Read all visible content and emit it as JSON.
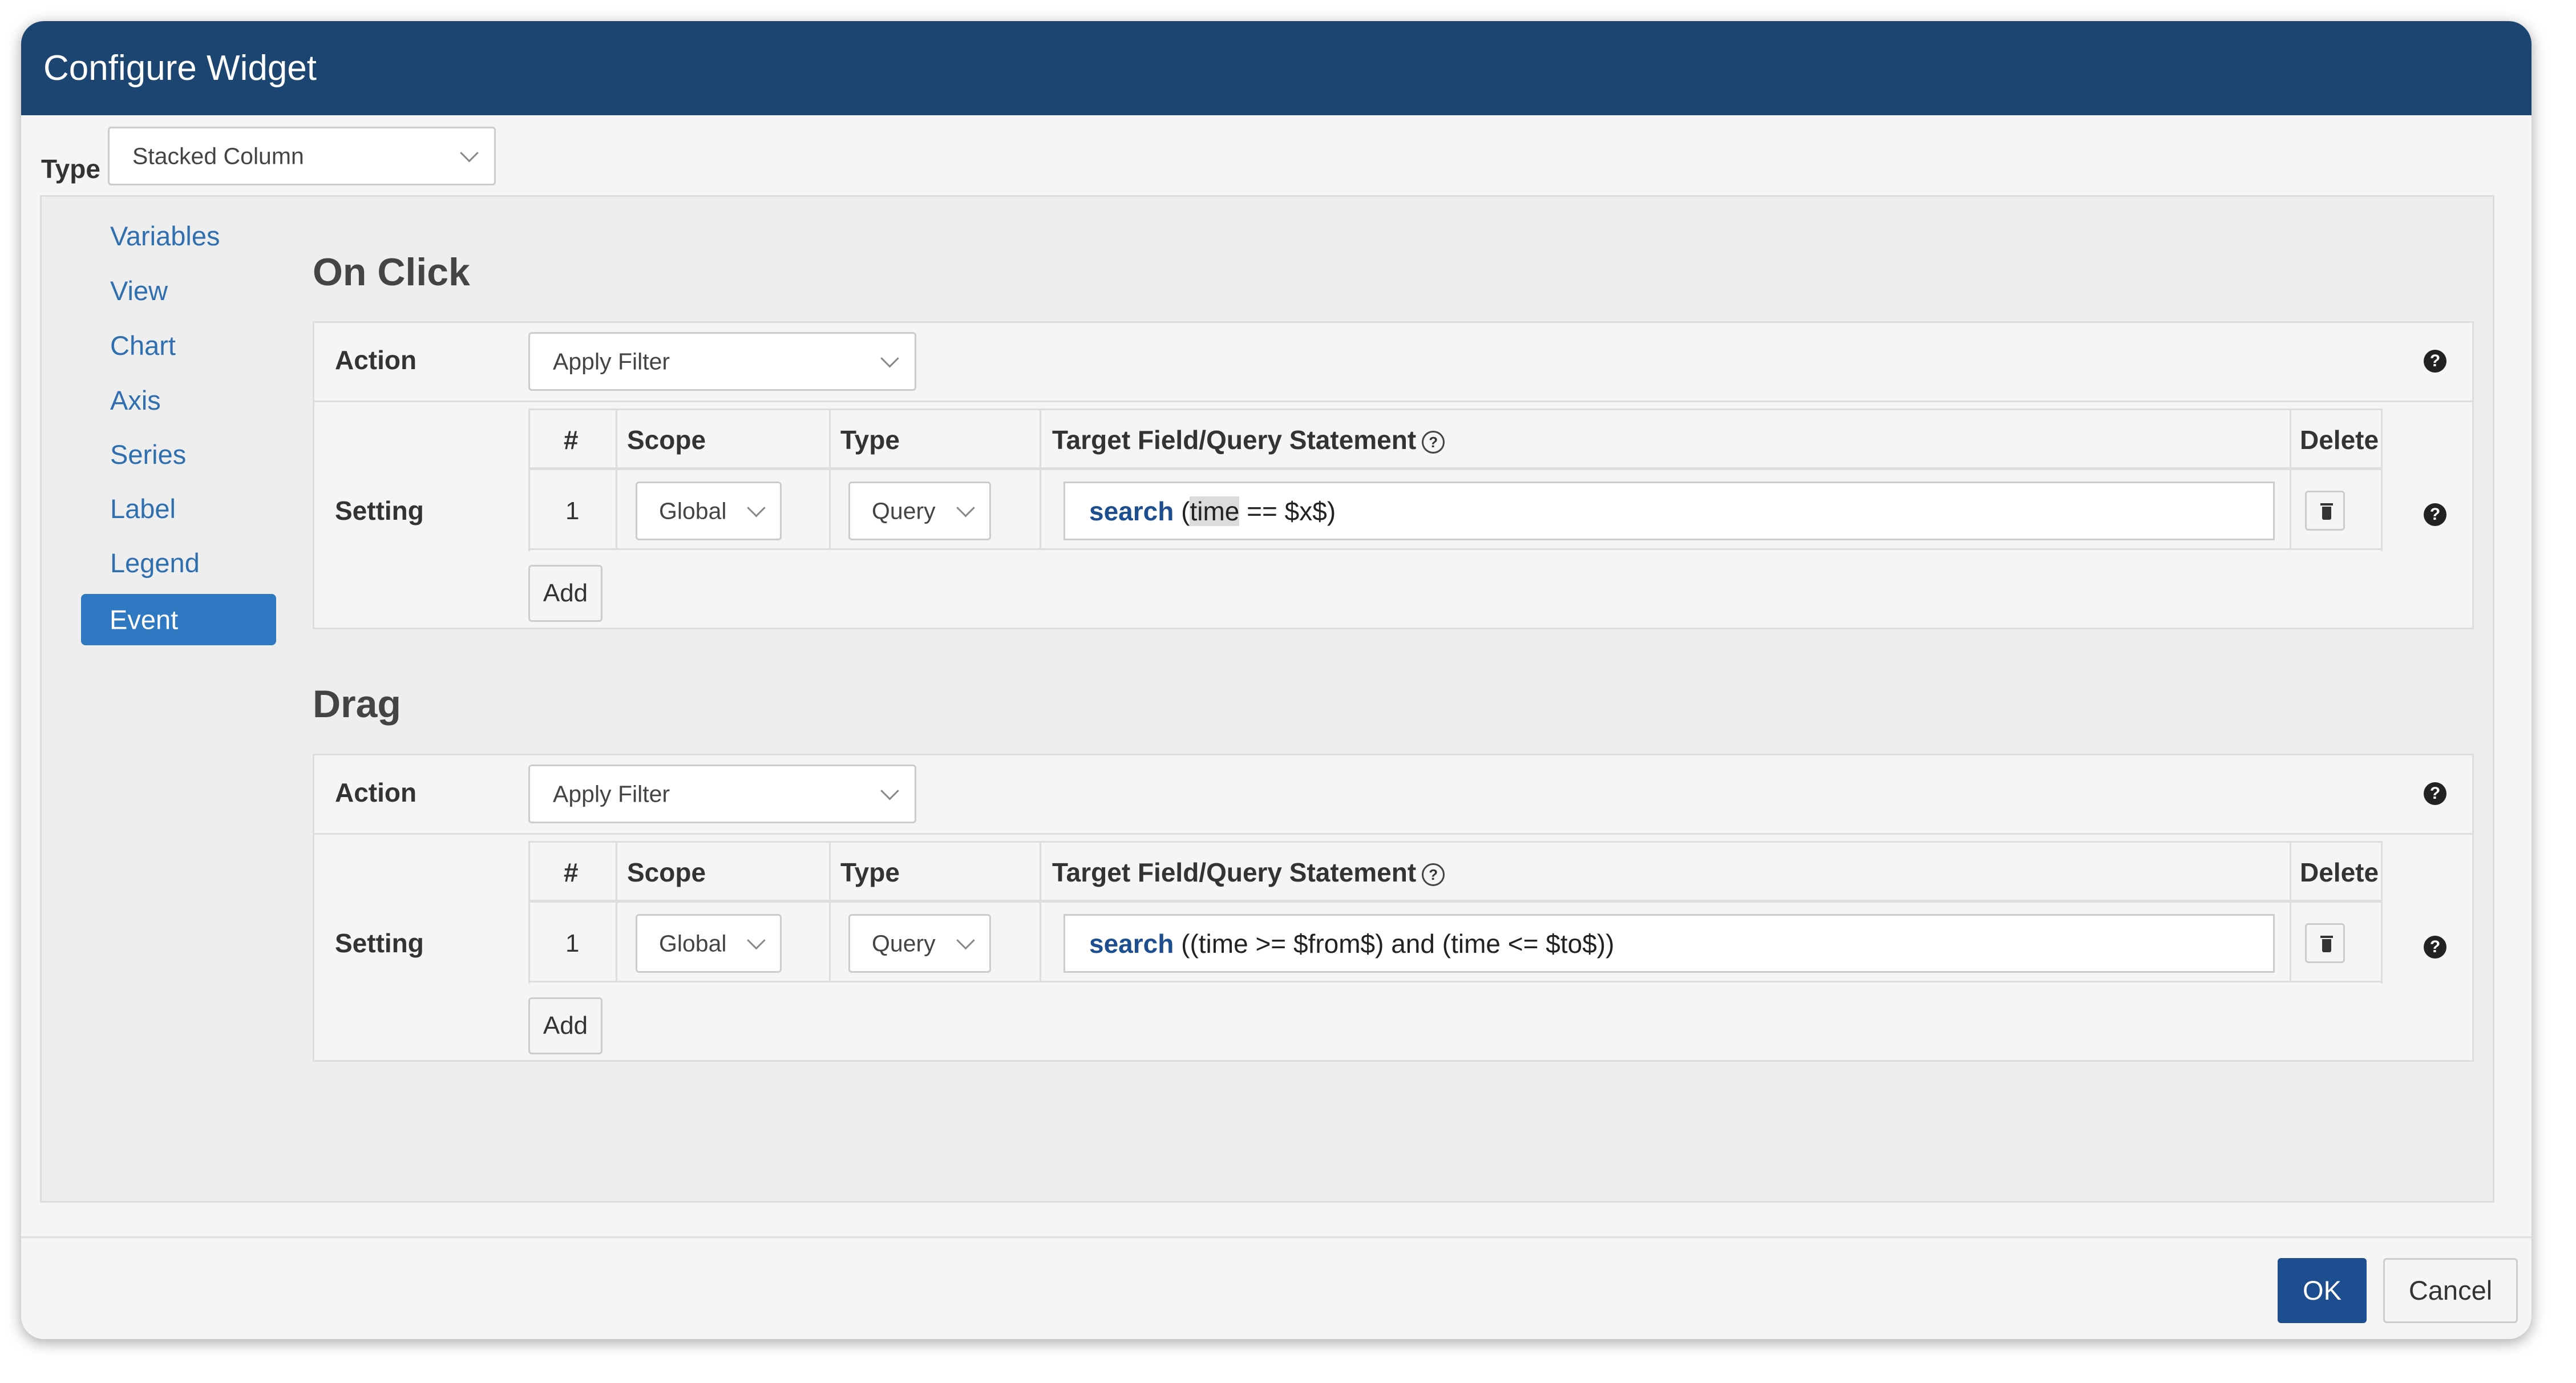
{
  "dialog": {
    "title": "Configure Widget"
  },
  "widget_type": {
    "label": "Type",
    "value": "Stacked Column"
  },
  "sidebar": {
    "items": [
      {
        "label": "Variables"
      },
      {
        "label": "View"
      },
      {
        "label": "Chart"
      },
      {
        "label": "Axis"
      },
      {
        "label": "Series"
      },
      {
        "label": "Label"
      },
      {
        "label": "Legend"
      },
      {
        "label": "Event",
        "active": true
      }
    ]
  },
  "sections": [
    {
      "title": "On Click",
      "action_label": "Action",
      "action_value": "Apply Filter",
      "setting_label": "Setting",
      "columns": {
        "num": "#",
        "scope": "Scope",
        "type": "Type",
        "target": "Target Field/Query Statement",
        "delete": "Delete"
      },
      "rows": [
        {
          "num": "1",
          "scope": "Global",
          "type": "Query",
          "query_keyword": "search",
          "query_before": "(",
          "query_highlight": "time",
          "query_after": " == $x$)"
        }
      ],
      "add_label": "Add"
    },
    {
      "title": "Drag",
      "action_label": "Action",
      "action_value": "Apply Filter",
      "setting_label": "Setting",
      "columns": {
        "num": "#",
        "scope": "Scope",
        "type": "Type",
        "target": "Target Field/Query Statement",
        "delete": "Delete"
      },
      "rows": [
        {
          "num": "1",
          "scope": "Global",
          "type": "Query",
          "query_keyword": "search",
          "query_rest": "((time >= $from$) and (time <= $to$))"
        }
      ],
      "add_label": "Add"
    }
  ],
  "icons": {
    "help": "question-circle-icon",
    "info": "info-circle-icon",
    "delete": "trash-icon",
    "dropdown": "chevron-down-icon"
  },
  "footer": {
    "ok_label": "OK",
    "cancel_label": "Cancel"
  },
  "colors": {
    "header": "#1d4571",
    "accent": "#2f78c2",
    "primary_button": "#1d4e8f",
    "link": "#2f6fb0"
  }
}
